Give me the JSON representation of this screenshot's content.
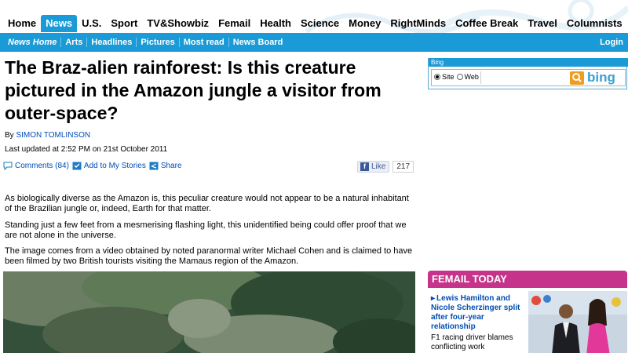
{
  "nav": {
    "items": [
      "Home",
      "News",
      "U.S.",
      "Sport",
      "TV&Showbiz",
      "Femail",
      "Health",
      "Science",
      "Money",
      "RightMinds",
      "Coffee Break",
      "Travel",
      "Columnists"
    ],
    "active": "News"
  },
  "subnav": {
    "items": [
      "News Home",
      "Arts",
      "Headlines",
      "Pictures",
      "Most read",
      "News Board"
    ],
    "login": "Login"
  },
  "article": {
    "headline": "The Braz-alien rainforest: Is this creature pictured in the Amazon jungle a visitor from outer-space?",
    "byline_prefix": "By",
    "author": "SIMON TOMLINSON",
    "updated": "Last updated at 2:52 PM on 21st October 2011",
    "actions": {
      "comments": "Comments (84)",
      "add": "Add to My Stories",
      "share": "Share"
    },
    "like": {
      "label": "Like",
      "count": "217"
    },
    "paragraphs": [
      "As biologically diverse as the Amazon is, this peculiar creature would not appear to be a natural inhabitant of the Brazilian jungle or, indeed, Earth for that matter.",
      "Standing just a few feet from a mesmerising flashing light, this unidentified being could offer proof that we are not alone in the universe.",
      "The image comes from a video obtained by noted paranormal writer Michael Cohen and is claimed to have been filmed by two British tourists visiting the Mamaus region of the Amazon."
    ]
  },
  "bing": {
    "label": "Bing",
    "option_site": "Site",
    "option_web": "Web",
    "logo": "bing"
  },
  "femail": {
    "title": "FEMAIL TODAY",
    "story": "Lewis Hamilton and Nicole Scherzinger split after four-year relationship",
    "sub": "F1 racing driver blames conflicting work"
  },
  "colors": {
    "nav_blue": "#1a9ad6",
    "link_blue": "#004db3",
    "femail_pink": "#c6338a",
    "bing_orange": "#f09c1e"
  }
}
